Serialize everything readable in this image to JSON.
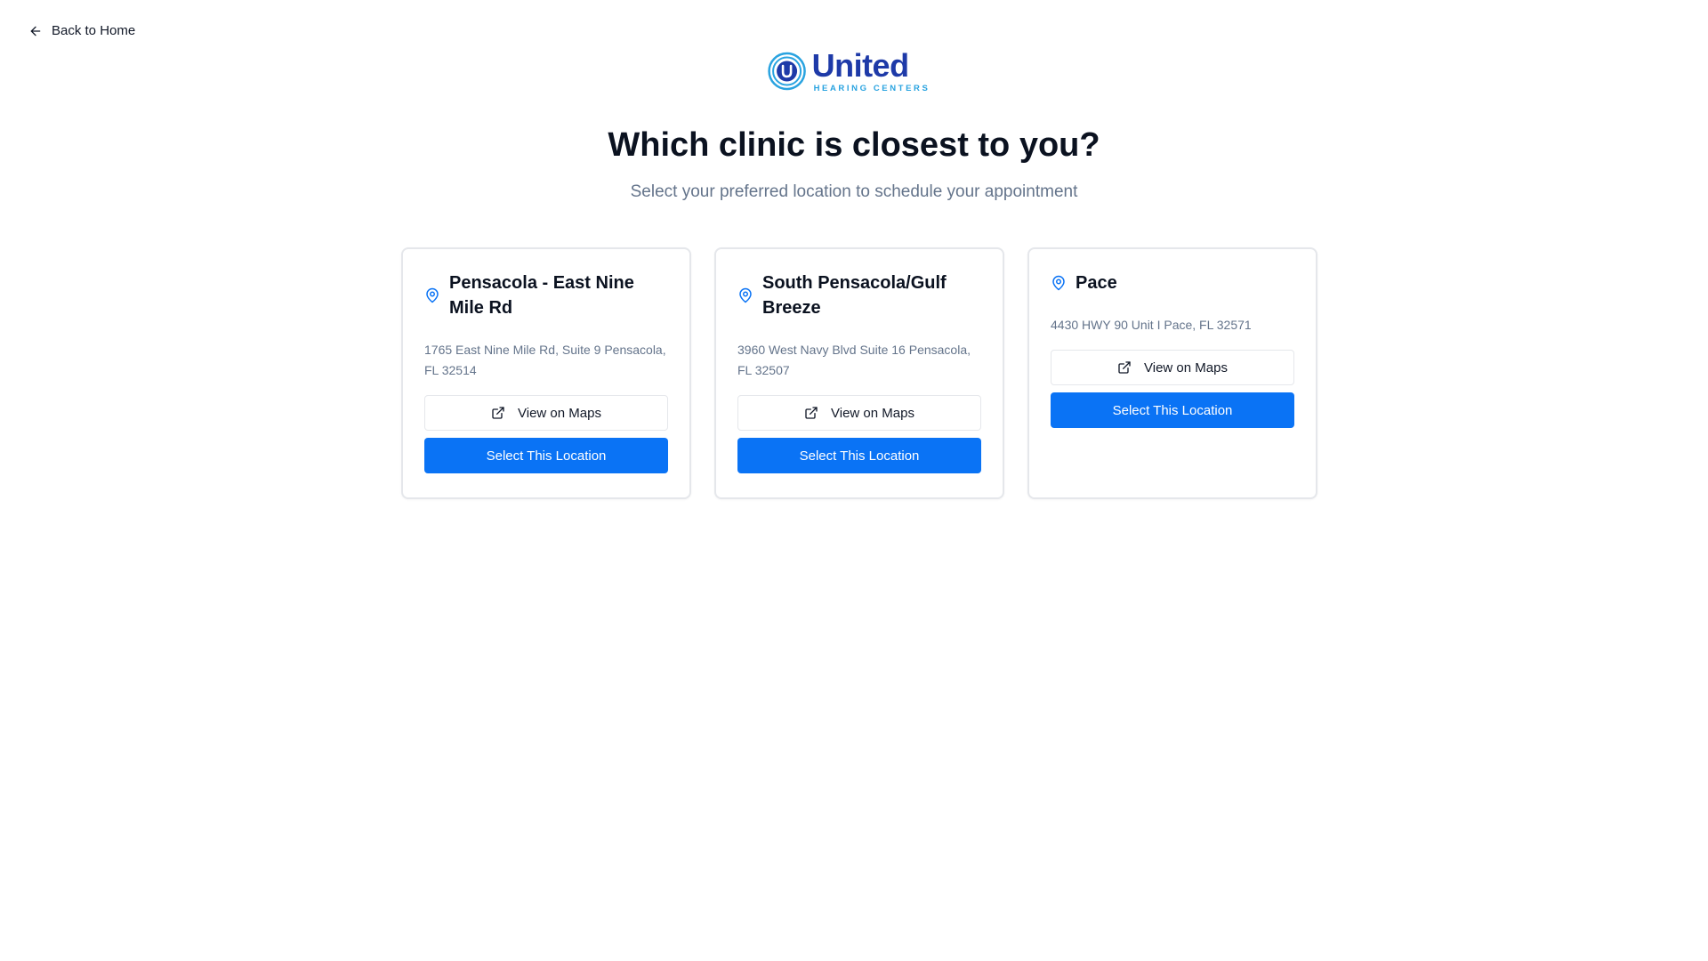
{
  "nav": {
    "back_label": "Back to Home"
  },
  "logo": {
    "name": "United",
    "subtitle": "HEARING CENTERS"
  },
  "header": {
    "title": "Which clinic is closest to you?",
    "subtitle": "Select your preferred location to schedule your appointment"
  },
  "locations": [
    {
      "name": "Pensacola - East Nine Mile Rd",
      "address": "1765 East Nine Mile Rd, Suite 9 Pensacola, FL 32514",
      "maps_label": "View on Maps",
      "select_label": "Select This Location"
    },
    {
      "name": "South Pensacola/Gulf Breeze",
      "address": "3960 West Navy Blvd Suite 16 Pensacola, FL 32507",
      "maps_label": "View on Maps",
      "select_label": "Select This Location"
    },
    {
      "name": "Pace",
      "address": "4430 HWY 90 Unit I Pace, FL 32571",
      "maps_label": "View on Maps",
      "select_label": "Select This Location"
    }
  ],
  "icons": {
    "back": "arrow-left-icon",
    "pin": "map-pin-icon",
    "external": "external-link-icon"
  },
  "colors": {
    "primary": "#0a73f5",
    "brand_dark": "#1e3aa8",
    "brand_light": "#29a3e0",
    "muted_text": "#64748b"
  }
}
